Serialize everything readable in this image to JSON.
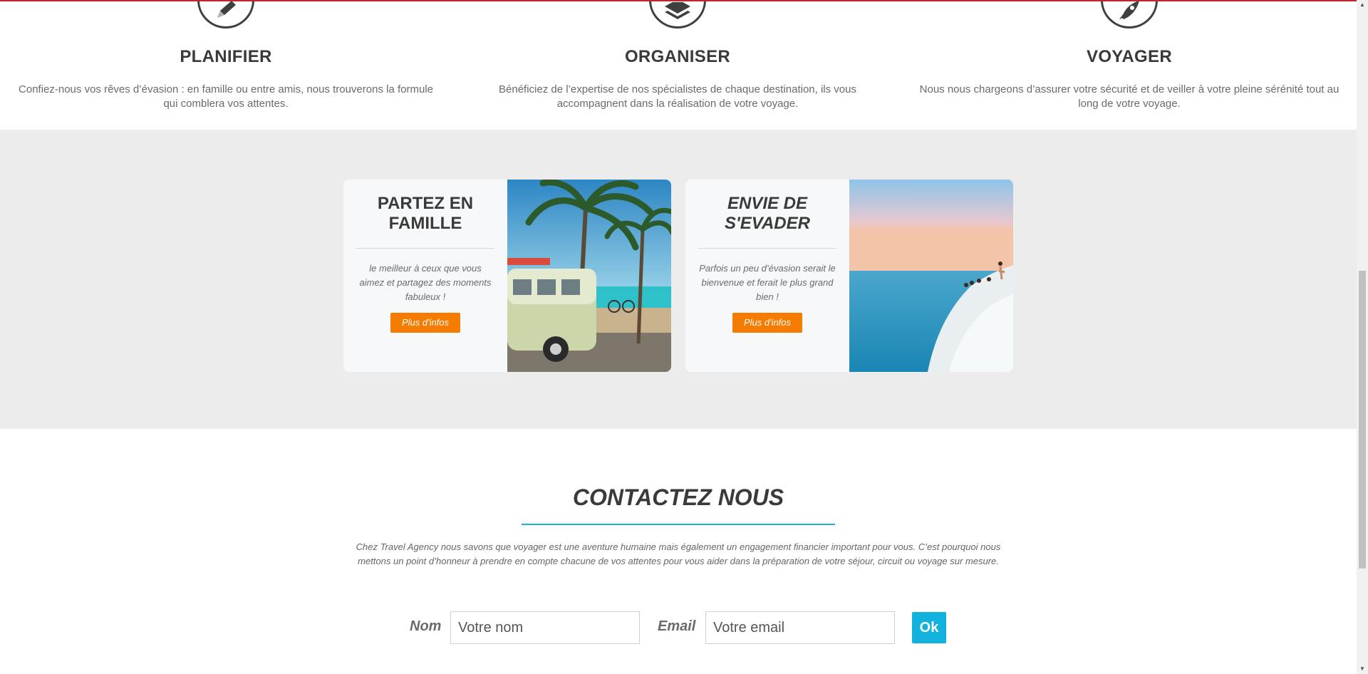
{
  "features": [
    {
      "title": "PLANIFIER",
      "icon": "pencil-icon",
      "text": "Confiez-nous vos rêves d’évasion : en famille ou entre amis, nous trouverons la formule qui comblera vos attentes."
    },
    {
      "title": "ORGANISER",
      "icon": "layers-icon",
      "text": "Bénéficiez de l’expertise de nos spécialistes de chaque destination, ils vous accompagnent dans la réalisation de votre voyage."
    },
    {
      "title": "VOYAGER",
      "icon": "rocket-icon",
      "text": "Nous nous chargeons d’assurer votre sécurité et de veiller à votre pleine sérénité tout au long de votre voyage."
    }
  ],
  "promos": [
    {
      "title": "PARTEZ EN FAMILLE",
      "text": "le meilleur à ceux que vous aimez et partagez des moments fabuleux !",
      "button": "Plus d'infos"
    },
    {
      "title": "ENVIE DE S'EVADER",
      "text": "Parfois un peu d’évasion serait le bienvenue et ferait le plus grand bien !",
      "button": "Plus d'infos"
    }
  ],
  "contact": {
    "title": "CONTACTEZ NOUS",
    "intro": "Chez Travel Agency nous savons que voyager est une aventure humaine mais également un engagement financier important pour vous. C’est pourquoi nous mettons un point d’honneur à prendre en compte chacune de vos attentes pour vous aider dans la préparation de votre séjour, circuit ou voyage sur mesure.",
    "name_label": "Nom",
    "name_placeholder": "Votre nom",
    "email_label": "Email",
    "email_placeholder": "Votre email",
    "submit_label": "Ok"
  },
  "colors": {
    "accent_orange": "#f57c00",
    "accent_blue": "#11b3de",
    "top_bar_red": "#c0272d",
    "band_gray": "#ececec"
  }
}
